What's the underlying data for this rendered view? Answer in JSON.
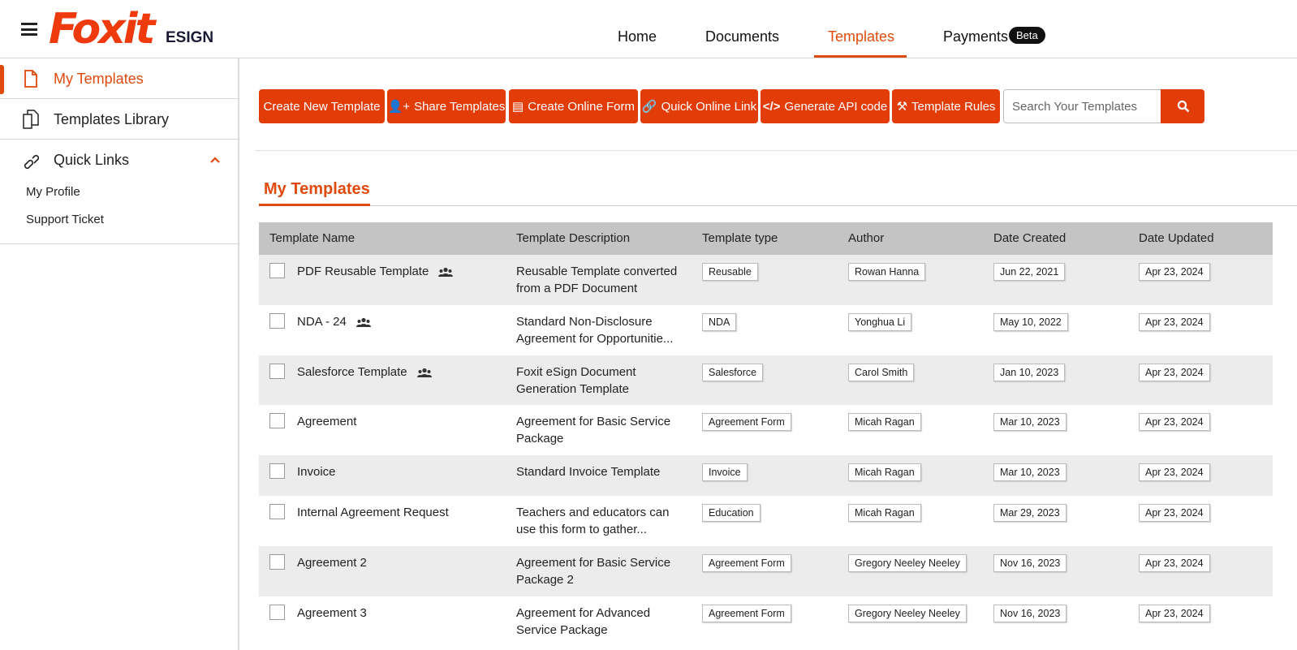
{
  "brand": {
    "logo": "Foxit",
    "product": "ESIGN"
  },
  "nav": [
    {
      "label": "Home"
    },
    {
      "label": "Documents"
    },
    {
      "label": "Templates"
    },
    {
      "label": "Payments",
      "badge": "Beta"
    }
  ],
  "sidebar": {
    "items": [
      {
        "label": "My Templates"
      },
      {
        "label": "Templates Library"
      },
      {
        "label": "Quick Links"
      }
    ],
    "sub": [
      {
        "label": "My Profile"
      },
      {
        "label": "Support Ticket"
      }
    ]
  },
  "toolbar": {
    "buttons": [
      "Create New Template",
      "Share Templates",
      "Create Online Form",
      "Quick Online Link",
      "Generate API code",
      "Template Rules"
    ],
    "search_placeholder": "Search Your Templates"
  },
  "section_title": "My Templates",
  "colors": {
    "accent": "#e23c08"
  },
  "table": {
    "headers": [
      "Template Name",
      "Template Description",
      "Template type",
      "Author",
      "Date Created",
      "Date Updated"
    ],
    "rows": [
      {
        "name": "PDF Reusable Template",
        "shared": true,
        "desc": "Reusable Template converted from a PDF Document",
        "type": "Reusable",
        "author": "Rowan Hanna",
        "created": "Jun 22, 2021",
        "updated": "Apr 23, 2024"
      },
      {
        "name": "NDA - 24",
        "shared": true,
        "desc": "Standard Non-Disclosure Agreement for Opportunitie...",
        "type": "NDA",
        "author": "Yonghua Li",
        "created": "May 10, 2022",
        "updated": "Apr 23, 2024"
      },
      {
        "name": "Salesforce Template",
        "shared": true,
        "desc": "Foxit eSign Document Generation Template",
        "type": "Salesforce",
        "author": "Carol Smith",
        "created": "Jan 10, 2023",
        "updated": "Apr 23, 2024"
      },
      {
        "name": "Agreement",
        "shared": false,
        "desc": "Agreement for Basic Service Package",
        "type": "Agreement Form",
        "author": "Micah Ragan",
        "created": "Mar 10, 2023",
        "updated": "Apr 23, 2024"
      },
      {
        "name": "Invoice",
        "shared": false,
        "desc": "Standard Invoice Template",
        "type": "Invoice",
        "author": "Micah Ragan",
        "created": "Mar 10, 2023",
        "updated": "Apr 23, 2024"
      },
      {
        "name": "Internal Agreement Request",
        "shared": false,
        "desc": "Teachers and educators can use this form to gather...",
        "type": "Education",
        "author": "Micah Ragan",
        "created": "Mar 29, 2023",
        "updated": "Apr 23, 2024"
      },
      {
        "name": "Agreement 2",
        "shared": false,
        "desc": "Agreement for Basic Service Package 2",
        "type": "Agreement Form",
        "author": "Gregory Neeley Neeley",
        "created": "Nov 16, 2023",
        "updated": "Apr 23, 2024"
      },
      {
        "name": "Agreement 3",
        "shared": false,
        "desc": "Agreement for Advanced Service Package",
        "type": "Agreement Form",
        "author": "Gregory Neeley Neeley",
        "created": "Nov 16, 2023",
        "updated": "Apr 23, 2024"
      }
    ]
  }
}
